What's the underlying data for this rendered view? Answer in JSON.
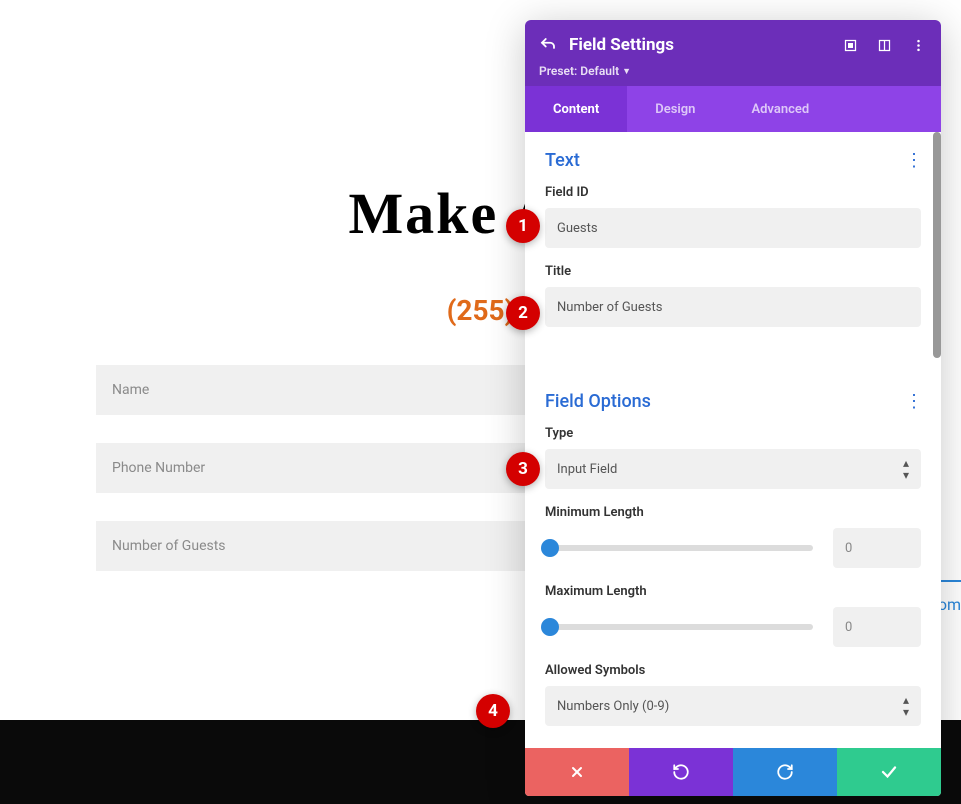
{
  "page": {
    "headline": "Make A R",
    "subhead": "(255)",
    "fields": [
      "Name",
      "Phone Number",
      "Number of Guests"
    ],
    "om_text": "om"
  },
  "panel": {
    "title": "Field Settings",
    "preset_label": "Preset:",
    "preset_value": "Default",
    "tabs": {
      "content": "Content",
      "design": "Design",
      "advanced": "Advanced"
    }
  },
  "text_section": {
    "title": "Text",
    "field_id_label": "Field ID",
    "field_id_value": "Guests",
    "title_label": "Title",
    "title_value": "Number of Guests"
  },
  "field_options": {
    "title": "Field Options",
    "type_label": "Type",
    "type_value": "Input Field",
    "min_len_label": "Minimum Length",
    "min_len_value": "0",
    "max_len_label": "Maximum Length",
    "max_len_value": "0",
    "allowed_label": "Allowed Symbols",
    "allowed_value": "Numbers Only (0-9)"
  },
  "badges": {
    "b1": "1",
    "b2": "2",
    "b3": "3",
    "b4": "4"
  }
}
